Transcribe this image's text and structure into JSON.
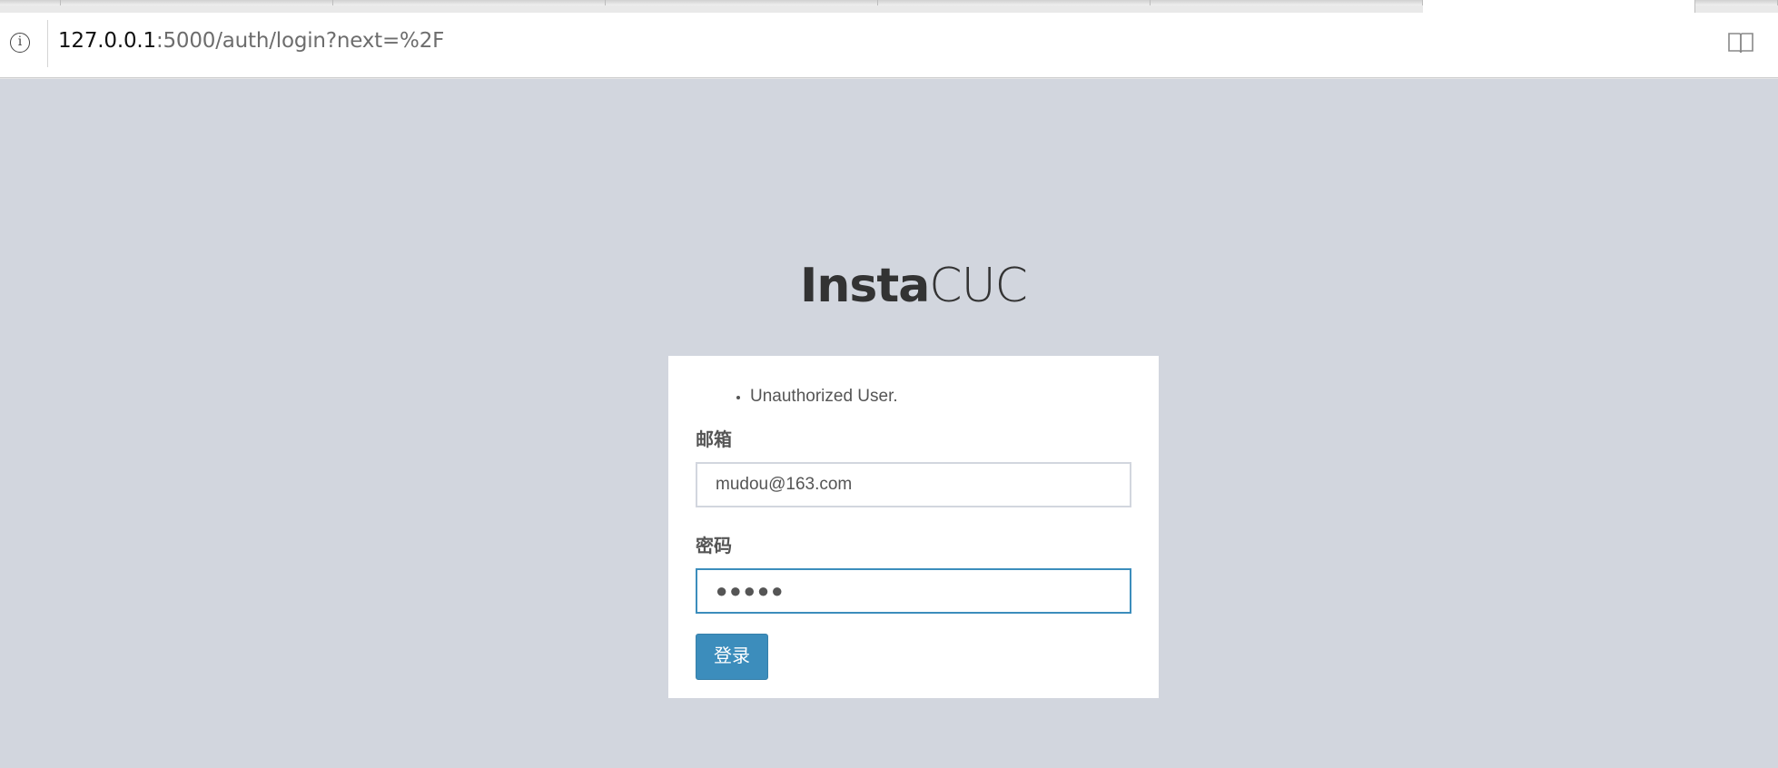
{
  "browser": {
    "url_host": "127.0.0.1",
    "url_rest": ":5000/auth/login?next=%2F",
    "info_icon": "info-icon",
    "reader_icon": "reader-view-icon"
  },
  "brand": {
    "bold": "Insta",
    "light": "CUC"
  },
  "login": {
    "errors": [
      "Unauthorized User."
    ],
    "email_label": "邮箱",
    "email_value": "mudou@163.com",
    "password_label": "密码",
    "password_value": "●●●●●",
    "submit_label": "登录"
  },
  "colors": {
    "background": "#d2d6de",
    "accent": "#3c8dbc"
  }
}
